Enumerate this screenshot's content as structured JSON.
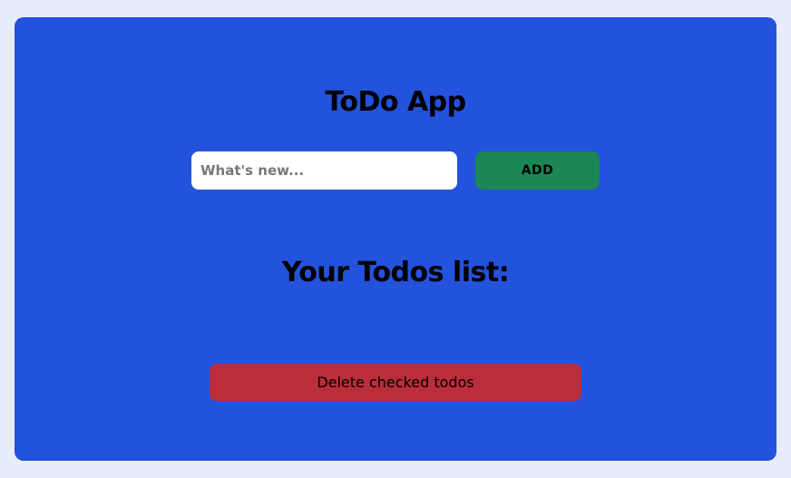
{
  "app": {
    "title": "ToDo App"
  },
  "form": {
    "input_placeholder": "What's new...",
    "input_value": "",
    "add_label": "ADD"
  },
  "list": {
    "heading": "Your Todos list:",
    "items": []
  },
  "actions": {
    "delete_checked_label": "Delete checked todos"
  },
  "colors": {
    "page_background": "#e8edfc",
    "card_background": "#2352dc",
    "add_button": "#1a8755",
    "delete_button": "#bb2d3b"
  }
}
